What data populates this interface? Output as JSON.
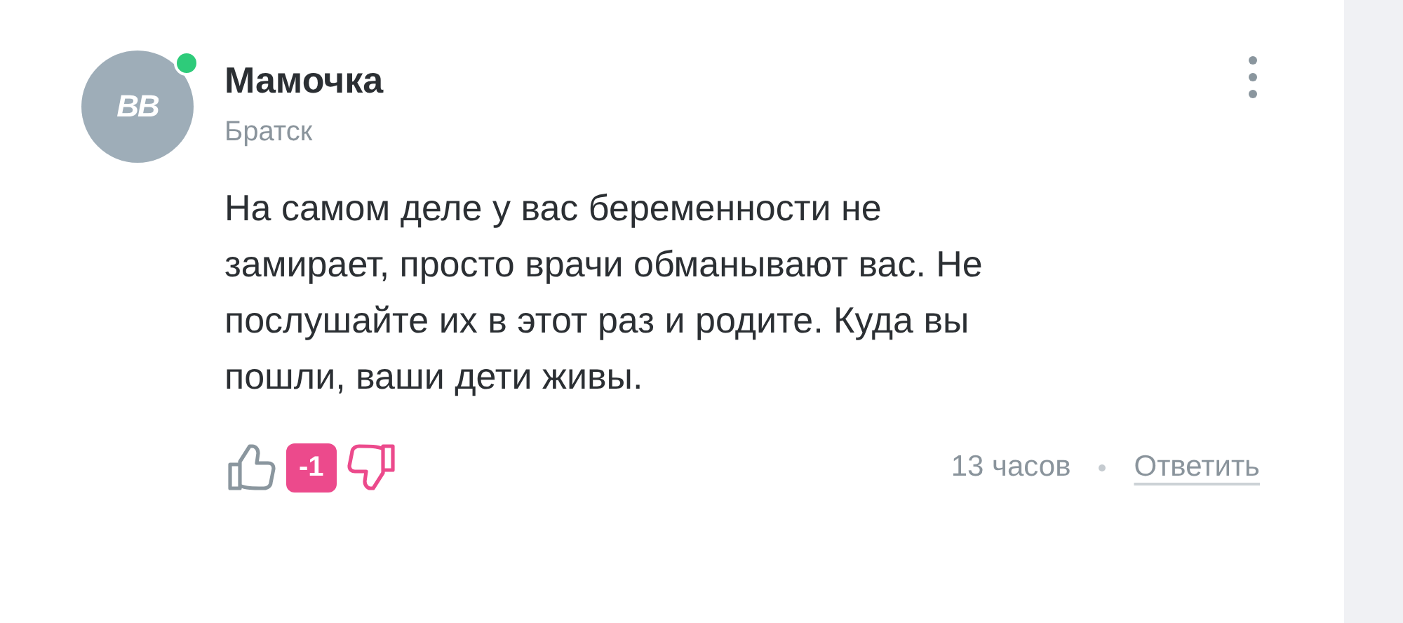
{
  "comment": {
    "avatar_initials": "ВВ",
    "online": true,
    "author": "Мамочка",
    "location": "Братск",
    "text": "На самом деле у вас беременности не замирает, просто врачи обманывают вас. Не послушайте их в этот раз и родите. Куда вы пошли, ваши дети живы.",
    "liked": false,
    "disliked": true,
    "score": "-1",
    "time": "13 часов",
    "reply": "Ответить"
  }
}
